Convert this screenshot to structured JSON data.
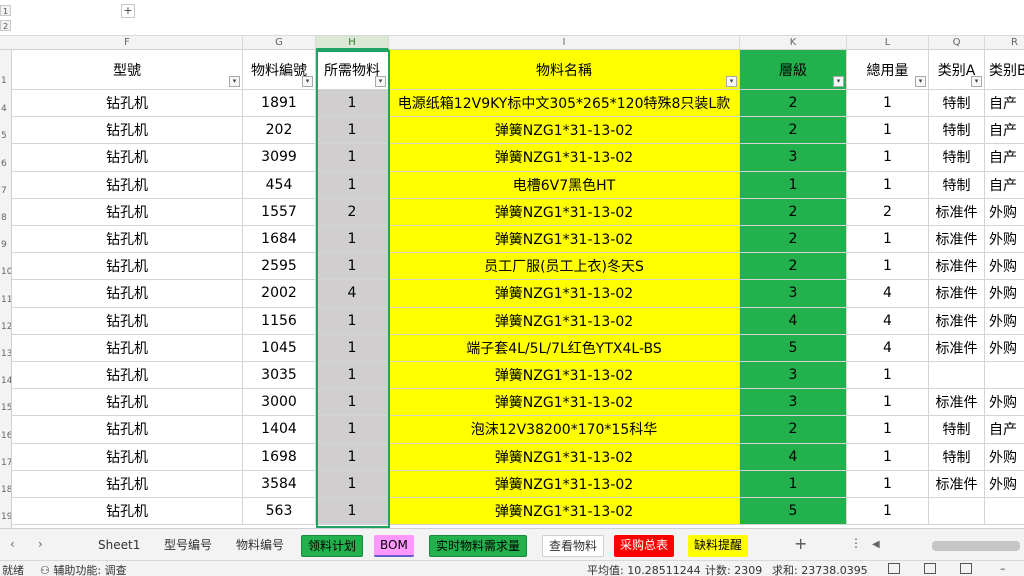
{
  "outline": {
    "levels": [
      "1",
      "2"
    ],
    "expand": "+"
  },
  "columns": [
    {
      "letter": "F",
      "header": "型號"
    },
    {
      "letter": "G",
      "header": "物料編號"
    },
    {
      "letter": "H",
      "header": "所需物料"
    },
    {
      "letter": "I",
      "header": "物料名稱"
    },
    {
      "letter": "K",
      "header": "層級"
    },
    {
      "letter": "L",
      "header": "總用量"
    },
    {
      "letter": "Q",
      "header": "类别A"
    },
    {
      "letter": "R",
      "header": "类别B"
    }
  ],
  "header_row_number": "1",
  "rows": [
    {
      "num": "4",
      "model": "钻孔机",
      "code": "1891",
      "qty": "1",
      "name": "电源纸箱12V9KY标中文305*265*120特殊8只装L款",
      "level": "2",
      "total": "1",
      "catA": "特制",
      "catB": "自产"
    },
    {
      "num": "5",
      "model": "钻孔机",
      "code": "202",
      "qty": "1",
      "name": "弹簧NZG1*31-13-02",
      "level": "2",
      "total": "1",
      "catA": "特制",
      "catB": "自产"
    },
    {
      "num": "6",
      "model": "钻孔机",
      "code": "3099",
      "qty": "1",
      "name": "弹簧NZG1*31-13-02",
      "level": "3",
      "total": "1",
      "catA": "特制",
      "catB": "自产"
    },
    {
      "num": "7",
      "model": "钻孔机",
      "code": "454",
      "qty": "1",
      "name": "电槽6V7黑色HT",
      "level": "1",
      "total": "1",
      "catA": "特制",
      "catB": "自产"
    },
    {
      "num": "8",
      "model": "钻孔机",
      "code": "1557",
      "qty": "2",
      "name": "弹簧NZG1*31-13-02",
      "level": "2",
      "total": "2",
      "catA": "标准件",
      "catB": "外购"
    },
    {
      "num": "9",
      "model": "钻孔机",
      "code": "1684",
      "qty": "1",
      "name": "弹簧NZG1*31-13-02",
      "level": "2",
      "total": "1",
      "catA": "标准件",
      "catB": "外购"
    },
    {
      "num": "10",
      "model": "钻孔机",
      "code": "2595",
      "qty": "1",
      "name": "员工厂服(员工上衣)冬天S",
      "level": "2",
      "total": "1",
      "catA": "标准件",
      "catB": "外购"
    },
    {
      "num": "11",
      "model": "钻孔机",
      "code": "2002",
      "qty": "4",
      "name": "弹簧NZG1*31-13-02",
      "level": "3",
      "total": "4",
      "catA": "标准件",
      "catB": "外购"
    },
    {
      "num": "12",
      "model": "钻孔机",
      "code": "1156",
      "qty": "1",
      "name": "弹簧NZG1*31-13-02",
      "level": "4",
      "total": "4",
      "catA": "标准件",
      "catB": "外购"
    },
    {
      "num": "13",
      "model": "钻孔机",
      "code": "1045",
      "qty": "1",
      "name": "端子套4L/5L/7L红色YTX4L-BS",
      "level": "5",
      "total": "4",
      "catA": "标准件",
      "catB": "外购"
    },
    {
      "num": "14",
      "model": "钻孔机",
      "code": "3035",
      "qty": "1",
      "name": "弹簧NZG1*31-13-02",
      "level": "3",
      "total": "1",
      "catA": "",
      "catB": ""
    },
    {
      "num": "15",
      "model": "钻孔机",
      "code": "3000",
      "qty": "1",
      "name": "弹簧NZG1*31-13-02",
      "level": "3",
      "total": "1",
      "catA": "标准件",
      "catB": "外购"
    },
    {
      "num": "16",
      "model": "钻孔机",
      "code": "1404",
      "qty": "1",
      "name": "泡沫12V38200*170*15科华",
      "level": "2",
      "total": "1",
      "catA": "特制",
      "catB": "自产"
    },
    {
      "num": "17",
      "model": "钻孔机",
      "code": "1698",
      "qty": "1",
      "name": "弹簧NZG1*31-13-02",
      "level": "4",
      "total": "1",
      "catA": "特制",
      "catB": "外购"
    },
    {
      "num": "18",
      "model": "钻孔机",
      "code": "3584",
      "qty": "1",
      "name": "弹簧NZG1*31-13-02",
      "level": "1",
      "total": "1",
      "catA": "标准件",
      "catB": "外购"
    },
    {
      "num": "19",
      "model": "钻孔机",
      "code": "563",
      "qty": "1",
      "name": "弹簧NZG1*31-13-02",
      "level": "5",
      "total": "1",
      "catA": "",
      "catB": ""
    }
  ],
  "sheet_tabs": [
    {
      "label": "Sheet1",
      "style": "none"
    },
    {
      "label": "型号编号",
      "style": "none"
    },
    {
      "label": "物料编号",
      "style": "none"
    },
    {
      "label": "领料计划",
      "style": "green"
    },
    {
      "label": "BOM",
      "style": "pink",
      "active": true
    },
    {
      "label": "实时物料需求量",
      "style": "green"
    },
    {
      "label": "查看物料",
      "style": "plain"
    },
    {
      "label": "采购总表",
      "style": "red"
    },
    {
      "label": "缺料提醒",
      "style": "yellow"
    }
  ],
  "tab_controls": {
    "add": "+",
    "more": "⋮"
  },
  "status": {
    "ready": "就绪",
    "accessibility": "辅助功能: 调查",
    "average": "平均值: 10.28511244",
    "count": "计数: 2309",
    "sum": "求和: 23738.0395"
  },
  "colors": {
    "yellow": "#ffff00",
    "green": "#22b14c",
    "grey_column": "#d0cece",
    "accent": "#21a366"
  }
}
